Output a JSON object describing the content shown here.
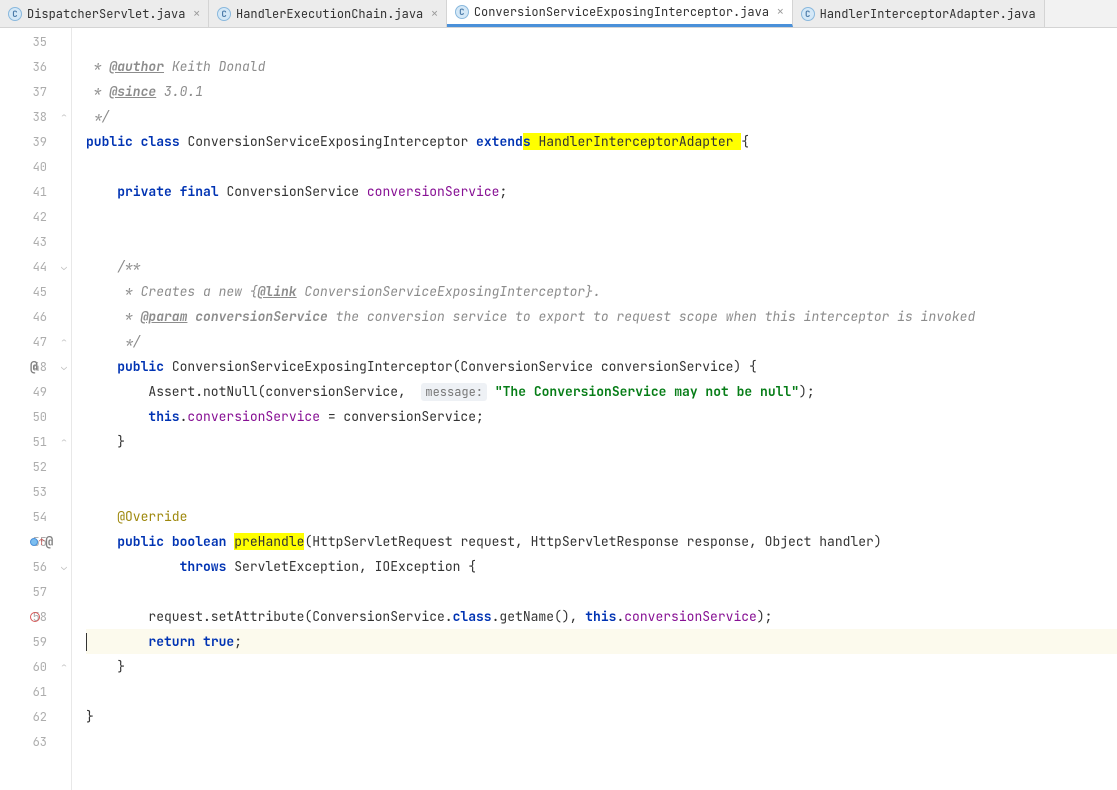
{
  "tabs": [
    {
      "label": "DispatcherServlet.java",
      "active": false
    },
    {
      "label": "HandlerExecutionChain.java",
      "active": false
    },
    {
      "label": "ConversionServiceExposingInterceptor.java",
      "active": true
    },
    {
      "label": "HandlerInterceptorAdapter.java",
      "active": false
    }
  ],
  "lines": {
    "l35": "35",
    "l36": "36",
    "l37": "37",
    "l38": "38",
    "l39": "39",
    "l40": "40",
    "l41": "41",
    "l42": "42",
    "l43": "43",
    "l44": "44",
    "l45": "45",
    "l46": "46",
    "l47": "47",
    "l48": "48",
    "l49": "49",
    "l50": "50",
    "l51": "51",
    "l52": "52",
    "l53": "53",
    "l54": "54",
    "l55": "55",
    "l56": "56",
    "l57": "57",
    "l58": "58",
    "l59": "59",
    "l60": "60",
    "l61": "61",
    "l62": "62",
    "l63": "63"
  },
  "code": {
    "c36a": " * ",
    "c36b": "@author",
    "c36c": " Keith Donald",
    "c37a": " * ",
    "c37b": "@since",
    "c37c": " 3.0.1",
    "c38": " */",
    "c39a": "public",
    "c39b": " ",
    "c39c": "class",
    "c39d": " ConversionServiceExposingInterceptor ",
    "c39e": "extend",
    "c39f": "s",
    "c39g": " HandlerInterceptorAdapter ",
    "c39h": "{",
    "c41a": "    ",
    "c41b": "private",
    "c41c": " ",
    "c41d": "final",
    "c41e": " ConversionService ",
    "c41f": "conversionService",
    "c41g": ";",
    "c44": "    /**",
    "c45a": "     * Creates a new {",
    "c45b": "@link",
    "c45c": " ConversionServiceExposingInterceptor}.",
    "c46a": "     * ",
    "c46b": "@param",
    "c46c": " ",
    "c46d": "conversionService",
    "c46e": " the conversion service to export to request scope when this interceptor is invoked",
    "c47": "     */",
    "c48a": "    ",
    "c48b": "public",
    "c48c": " ConversionServiceExposingInterceptor(ConversionService conversionService) {",
    "c49a": "        Assert.notNull(conversionService,  ",
    "c49hint": "message:",
    "c49b": " ",
    "c49c": "\"The ConversionService may not be null\"",
    "c49d": ");",
    "c50a": "        ",
    "c50b": "this",
    "c50c": ".",
    "c50d": "conversionService",
    "c50e": " = conversionService;",
    "c51": "    }",
    "c54a": "    ",
    "c54b": "@Override",
    "c55a": "    ",
    "c55b": "public",
    "c55c": " ",
    "c55d": "boolean",
    "c55e": " ",
    "c55f": "preHandle",
    "c55g": "(HttpServletRequest request, HttpServletResponse response, Object handler)",
    "c56a": "            ",
    "c56b": "throws",
    "c56c": " ServletException, IOException {",
    "c58a": "        request.setAttribute(ConversionService.",
    "c58b": "class",
    "c58c": ".getName(), ",
    "c58d": "this",
    "c58e": ".",
    "c58f": "conversionService",
    "c58g": ");",
    "c59a": "        ",
    "c59b": "return",
    "c59c": " ",
    "c59d": "true",
    "c59e": ";",
    "c60": "    }",
    "c62": "}"
  },
  "gutter_badges": {
    "at": "@",
    "arrow": "↑"
  }
}
